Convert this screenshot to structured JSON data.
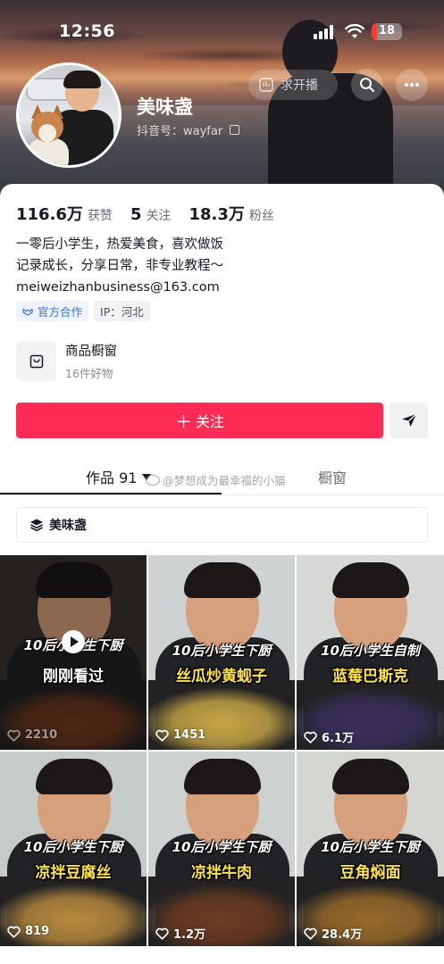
{
  "status_bar": {
    "time": "12:56",
    "battery_level": "18",
    "battery_fraction": 0.18
  },
  "header": {
    "live_label": "求开播",
    "nickname": "美味盏",
    "douyin_id": "抖音号：wayfar"
  },
  "stats": [
    {
      "value": "116.6万",
      "label": "获赞"
    },
    {
      "value": "5",
      "label": "关注"
    },
    {
      "value": "18.3万",
      "label": "粉丝"
    }
  ],
  "bio": [
    "一零后小学生，热爱美食，喜欢做饭",
    "记录成长，分享日常，非专业教程～",
    "meiweizhanbusiness@163.com"
  ],
  "tags": {
    "official": "官方合作",
    "ip": "IP：河北"
  },
  "shop": {
    "title": "商品橱窗",
    "subtitle": "16件好物"
  },
  "actions": {
    "follow_label": "关注"
  },
  "tabs": {
    "works_label": "作品 91",
    "shop_label": "橱窗"
  },
  "watermark": "@梦想成为最幸福的小猫",
  "collection": {
    "label": "美味盏"
  },
  "videos": [
    {
      "caption_top": "10后小学生下厨",
      "caption_main": "刚刚看过",
      "likes": "2210",
      "viewed": true,
      "food_color": "#7a3b1e",
      "bg_color": "#3a3430"
    },
    {
      "caption_top": "10后小学生下厨",
      "caption_main": "丝瓜炒黄蚬子",
      "likes": "1451",
      "viewed": false,
      "food_color": "#c8a646",
      "bg_color": "#cfd2d2"
    },
    {
      "caption_top": "10后小学生自制",
      "caption_main": "蓝莓巴斯克",
      "likes": "6.1万",
      "viewed": false,
      "food_color": "#3b2f5e",
      "bg_color": "#d6d8d6"
    },
    {
      "caption_top": "10后小学生下厨",
      "caption_main": "凉拌豆腐丝",
      "likes": "819",
      "viewed": false,
      "food_color": "#b98a3e",
      "bg_color": "#c5cbc9"
    },
    {
      "caption_top": "10后小学生下厨",
      "caption_main": "凉拌牛肉",
      "likes": "1.2万",
      "viewed": false,
      "food_color": "#6e3a22",
      "bg_color": "#cdd2d0"
    },
    {
      "caption_top": "10后小学生下厨",
      "caption_main": "豆角焖面",
      "likes": "28.4万",
      "viewed": false,
      "food_color": "#9a6a2a",
      "bg_color": "#d4d6d2"
    }
  ],
  "colors": {
    "accent": "#fe2c55",
    "text_primary": "#161823",
    "text_secondary": "#6b6d74",
    "official_blue": "#3a73e0"
  }
}
